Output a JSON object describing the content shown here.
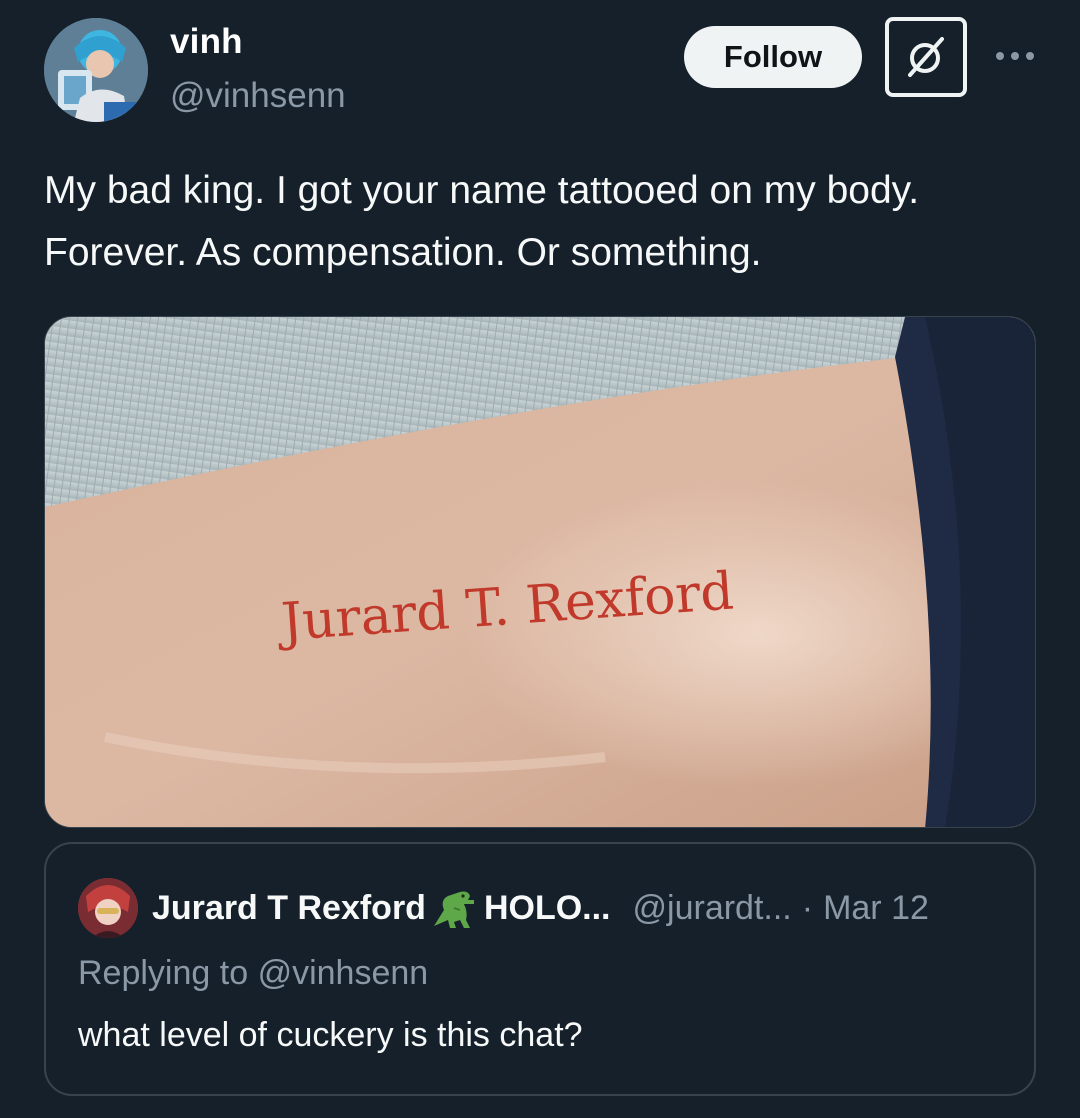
{
  "author": {
    "display_name": "vinh",
    "handle": "@vinhsenn",
    "avatar_icon": "user-avatar"
  },
  "actions": {
    "follow_label": "Follow",
    "grok_icon": "grok-icon",
    "more_icon": "more-icon"
  },
  "post": {
    "text": "My bad king. I got your name tattooed on my body. Forever. As compensation. Or something."
  },
  "media": {
    "tattoo_text": "Jurard T. Rexford",
    "description_icon": "photo"
  },
  "quote": {
    "name": "Jurard T Rexford",
    "name_emoji_icon": "t-rex-icon",
    "name_suffix": "HOLO...",
    "handle": "@jurardt...",
    "separator": "·",
    "date": "Mar 12",
    "replying_prefix": "Replying to",
    "replying_handle": "@vinhsenn",
    "text": "what level of cuckery is this chat?"
  },
  "colors": {
    "background": "#15202b",
    "secondary_text": "#8b98a5",
    "border": "#38444d",
    "follow_bg": "#eff3f4",
    "tattoo_ink": "#c0392b"
  }
}
